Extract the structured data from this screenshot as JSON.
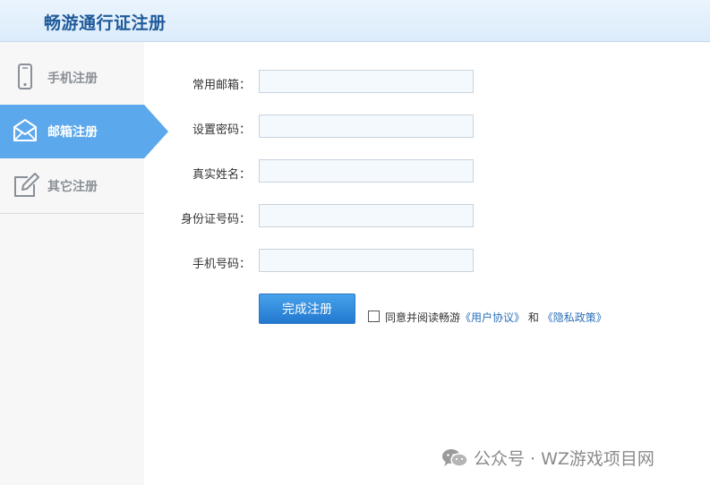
{
  "header": {
    "title": "畅游通行证注册"
  },
  "sidebar": {
    "items": [
      {
        "label": "手机注册",
        "icon": "phone-icon"
      },
      {
        "label": "邮箱注册",
        "icon": "envelope-icon",
        "active": true
      },
      {
        "label": "其它注册",
        "icon": "edit-icon"
      }
    ]
  },
  "form": {
    "fields": [
      {
        "label": "常用邮箱：",
        "value": ""
      },
      {
        "label": "设置密码：",
        "value": ""
      },
      {
        "label": "真实姓名：",
        "value": ""
      },
      {
        "label": "身份证号码：",
        "value": ""
      },
      {
        "label": "手机号码：",
        "value": ""
      }
    ],
    "submit_label": "完成注册",
    "agree": {
      "text": "同意并阅读畅游",
      "link1": "《用户协议》",
      "and": "和",
      "link2": "《隐私政策》",
      "checked": false
    }
  },
  "watermark": {
    "text": "公众号 · WZ游戏项目网",
    "icon": "wechat-icon"
  },
  "colors": {
    "accent": "#5ca8ec",
    "header_title": "#1f5a9a",
    "button": "#2278d0",
    "link": "#2a6fb8"
  }
}
